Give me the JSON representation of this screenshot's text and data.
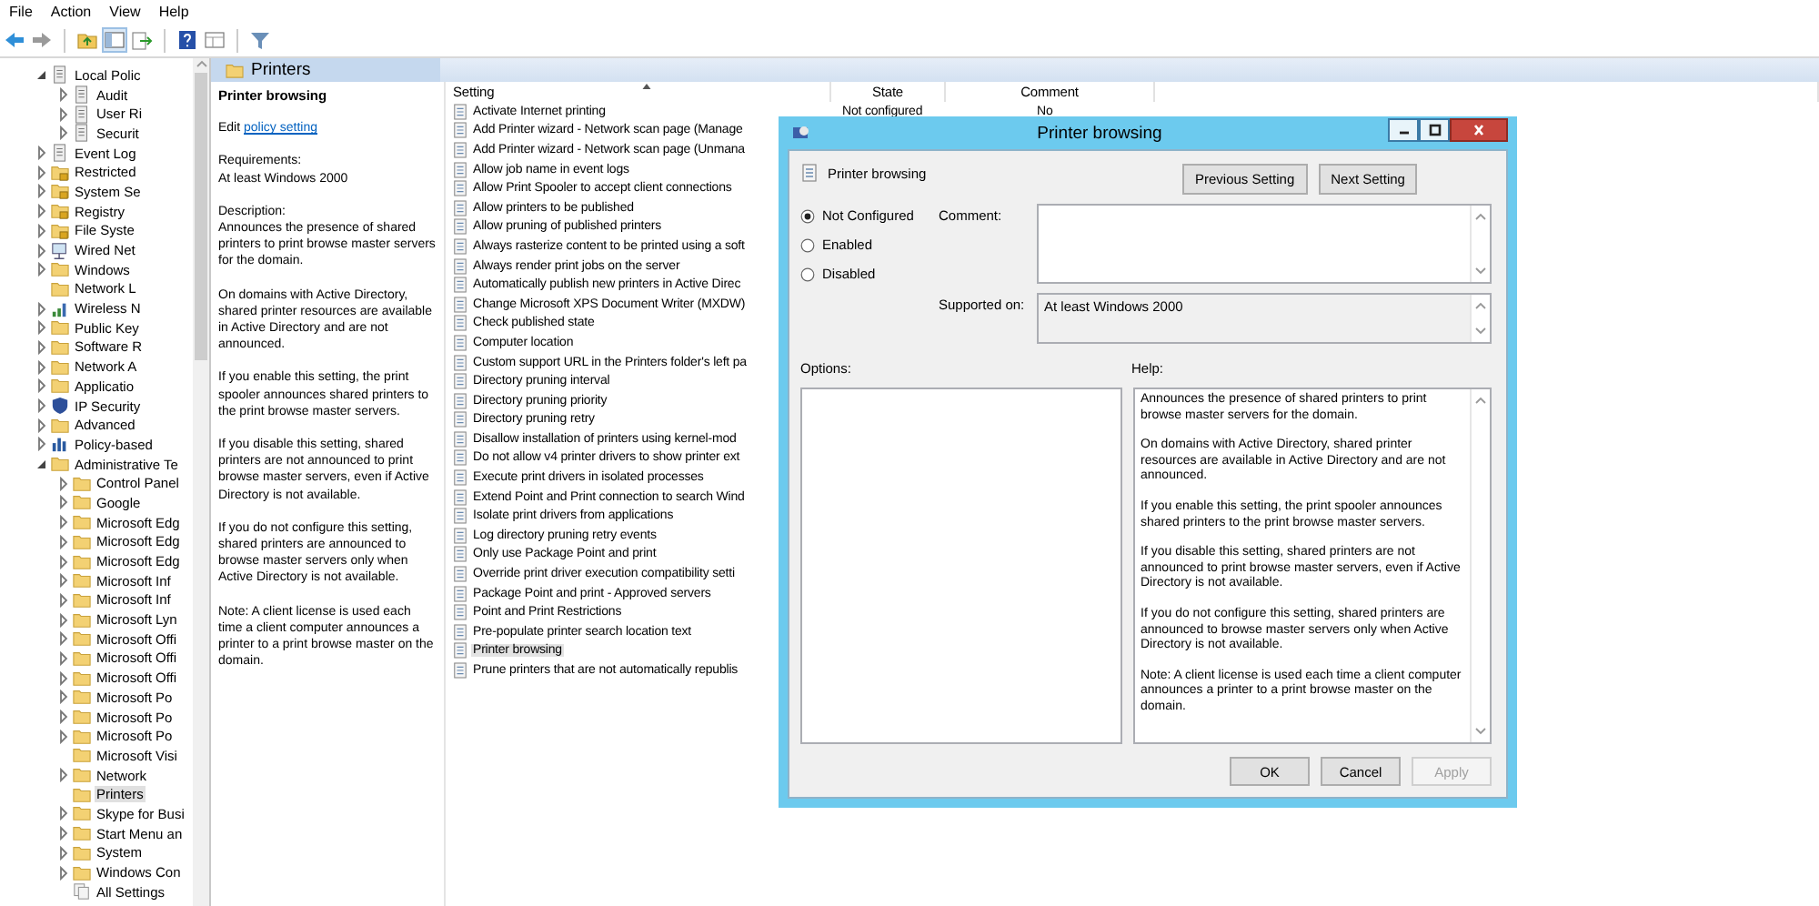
{
  "menu": [
    "File",
    "Action",
    "View",
    "Help"
  ],
  "tree": [
    {
      "label": "Local Polic",
      "kind": "policy",
      "expandable": true,
      "expanded": true,
      "selected": false,
      "children": [
        {
          "label": "Audit",
          "kind": "policy",
          "expandable": true,
          "expanded": false,
          "selected": false
        },
        {
          "label": "User Ri",
          "kind": "policy",
          "expandable": true,
          "expanded": false,
          "selected": false
        },
        {
          "label": "Securit",
          "kind": "policy",
          "expandable": true,
          "expanded": false,
          "selected": false
        }
      ]
    },
    {
      "label": "Event Log",
      "kind": "policy",
      "expandable": true,
      "expanded": false,
      "selected": false
    },
    {
      "label": "Restricted",
      "kind": "locked-folder",
      "expandable": true,
      "expanded": false,
      "selected": false
    },
    {
      "label": "System Se",
      "kind": "locked-folder",
      "expandable": true,
      "expanded": false,
      "selected": false
    },
    {
      "label": "Registry",
      "kind": "locked-folder",
      "expandable": true,
      "expanded": false,
      "selected": false
    },
    {
      "label": "File Syste",
      "kind": "locked-folder",
      "expandable": true,
      "expanded": false,
      "selected": false
    },
    {
      "label": "Wired Net",
      "kind": "network",
      "expandable": true,
      "expanded": false,
      "selected": false
    },
    {
      "label": "Windows",
      "kind": "folder",
      "expandable": true,
      "expanded": false,
      "selected": false
    },
    {
      "label": "Network L",
      "kind": "folder",
      "expandable": false,
      "selected": false
    },
    {
      "label": "Wireless N",
      "kind": "wireless",
      "expandable": true,
      "expanded": false,
      "selected": false
    },
    {
      "label": "Public Key",
      "kind": "folder",
      "expandable": true,
      "expanded": false,
      "selected": false
    },
    {
      "label": "Software R",
      "kind": "folder",
      "expandable": true,
      "expanded": false,
      "selected": false
    },
    {
      "label": "Network A",
      "kind": "folder",
      "expandable": true,
      "expanded": false,
      "selected": false
    },
    {
      "label": "Applicatio",
      "kind": "folder",
      "expandable": true,
      "expanded": false,
      "selected": false
    },
    {
      "label": "IP Security",
      "kind": "shield",
      "expandable": true,
      "expanded": false,
      "selected": false
    },
    {
      "label": "Advanced",
      "kind": "folder",
      "expandable": true,
      "expanded": false,
      "selected": false
    },
    {
      "label": "Policy-based",
      "kind": "chart",
      "expandable": true,
      "expanded": false,
      "selected": false
    },
    {
      "label": "Administrative Te",
      "kind": "folder",
      "expandable": true,
      "expanded": true,
      "selected": false,
      "children": [
        {
          "label": "Control Panel",
          "kind": "folder",
          "expandable": true,
          "expanded": false,
          "selected": false
        },
        {
          "label": "Google",
          "kind": "folder",
          "expandable": true,
          "expanded": false,
          "selected": false
        },
        {
          "label": "Microsoft Edg",
          "kind": "folder",
          "expandable": true,
          "expanded": false,
          "selected": false
        },
        {
          "label": "Microsoft Edg",
          "kind": "folder",
          "expandable": true,
          "expanded": false,
          "selected": false
        },
        {
          "label": "Microsoft Edg",
          "kind": "folder",
          "expandable": true,
          "expanded": false,
          "selected": false
        },
        {
          "label": "Microsoft Inf",
          "kind": "folder",
          "expandable": true,
          "expanded": false,
          "selected": false
        },
        {
          "label": "Microsoft Inf",
          "kind": "folder",
          "expandable": true,
          "expanded": false,
          "selected": false
        },
        {
          "label": "Microsoft Lyn",
          "kind": "folder",
          "expandable": true,
          "expanded": false,
          "selected": false
        },
        {
          "label": "Microsoft Offi",
          "kind": "folder",
          "expandable": true,
          "expanded": false,
          "selected": false
        },
        {
          "label": "Microsoft Offi",
          "kind": "folder",
          "expandable": true,
          "expanded": false,
          "selected": false
        },
        {
          "label": "Microsoft Offi",
          "kind": "folder",
          "expandable": true,
          "expanded": false,
          "selected": false
        },
        {
          "label": "Microsoft Po",
          "kind": "folder",
          "expandable": true,
          "expanded": false,
          "selected": false
        },
        {
          "label": "Microsoft Po",
          "kind": "folder",
          "expandable": true,
          "expanded": false,
          "selected": false
        },
        {
          "label": "Microsoft Po",
          "kind": "folder",
          "expandable": true,
          "expanded": false,
          "selected": false
        },
        {
          "label": "Microsoft Visi",
          "kind": "folder",
          "expandable": false,
          "selected": false
        },
        {
          "label": "Network",
          "kind": "folder",
          "expandable": true,
          "expanded": false,
          "selected": false
        },
        {
          "label": "Printers",
          "kind": "folder",
          "expandable": false,
          "selected": true
        },
        {
          "label": "Skype for Busi",
          "kind": "folder",
          "expandable": true,
          "expanded": false,
          "selected": false
        },
        {
          "label": "Start Menu an",
          "kind": "folder",
          "expandable": true,
          "expanded": false,
          "selected": false
        },
        {
          "label": "System",
          "kind": "folder",
          "expandable": true,
          "expanded": false,
          "selected": false
        },
        {
          "label": "Windows Con",
          "kind": "folder",
          "expandable": true,
          "expanded": false,
          "selected": false
        },
        {
          "label": "All Settings",
          "kind": "settings",
          "expandable": false,
          "selected": false
        }
      ]
    }
  ],
  "details": {
    "header": "Printers",
    "title": "Printer browsing",
    "edit_prefix": "Edit",
    "edit_link": "policy setting",
    "requirements_label": "Requirements:",
    "requirements": "At least Windows 2000",
    "description_label": "Description:",
    "paragraphs": [
      "Announces the presence of shared printers to print browse master servers for the domain.",
      "On domains with Active Directory, shared printer resources are available in Active Directory and are not announced.",
      "If you enable this setting, the print spooler announces shared printers to the print browse master servers.",
      "If you disable this setting, shared printers are not announced to print browse master servers, even if Active Directory is not available.",
      "If you do not configure this setting, shared printers are announced to browse master servers only when Active Directory is not available.",
      "Note: A client license is used each time a client computer announces a printer to a print browse master on the domain."
    ]
  },
  "list": {
    "columns": [
      "Setting",
      "State",
      "Comment"
    ],
    "rows": [
      {
        "setting": "Activate Internet printing",
        "state": "Not configured",
        "comment": "No",
        "selected": false
      },
      {
        "setting": "Add Printer wizard - Network scan page (Manage",
        "selected": false
      },
      {
        "setting": "Add Printer wizard - Network scan page (Unmana",
        "selected": false
      },
      {
        "setting": "Allow job name in event logs",
        "selected": false
      },
      {
        "setting": "Allow Print Spooler to accept client connections",
        "selected": false
      },
      {
        "setting": "Allow printers to be published",
        "selected": false
      },
      {
        "setting": "Allow pruning of published printers",
        "selected": false
      },
      {
        "setting": "Always rasterize content to be printed using a soft",
        "selected": false
      },
      {
        "setting": "Always render print jobs on the server",
        "selected": false
      },
      {
        "setting": "Automatically publish new printers in Active Direc",
        "selected": false
      },
      {
        "setting": "Change Microsoft XPS Document Writer (MXDW)",
        "selected": false
      },
      {
        "setting": "Check published state",
        "selected": false
      },
      {
        "setting": "Computer location",
        "selected": false
      },
      {
        "setting": "Custom support URL in the Printers folder's left pa",
        "selected": false
      },
      {
        "setting": "Directory pruning interval",
        "selected": false
      },
      {
        "setting": "Directory pruning priority",
        "selected": false
      },
      {
        "setting": "Directory pruning retry",
        "selected": false
      },
      {
        "setting": "Disallow installation of printers using kernel-mod",
        "selected": false
      },
      {
        "setting": "Do not allow v4 printer drivers to show printer ext",
        "selected": false
      },
      {
        "setting": "Execute print drivers in isolated processes",
        "selected": false
      },
      {
        "setting": "Extend Point and Print connection to search Wind",
        "selected": false
      },
      {
        "setting": "Isolate print drivers from applications",
        "selected": false
      },
      {
        "setting": "Log directory pruning retry events",
        "selected": false
      },
      {
        "setting": "Only use Package Point and print",
        "selected": false
      },
      {
        "setting": "Override print driver execution compatibility setti",
        "selected": false
      },
      {
        "setting": "Package Point and print - Approved servers",
        "selected": false
      },
      {
        "setting": "Point and Print Restrictions",
        "selected": false
      },
      {
        "setting": "Pre-populate printer search location text",
        "selected": false
      },
      {
        "setting": "Printer browsing",
        "selected": true
      },
      {
        "setting": "Prune printers that are not automatically republis",
        "selected": false
      }
    ]
  },
  "dialog": {
    "title": "Printer browsing",
    "policy_name": "Printer browsing",
    "nav_buttons": [
      "Previous Setting",
      "Next Setting"
    ],
    "options": [
      {
        "label": "Not Configured",
        "selected": true
      },
      {
        "label": "Enabled",
        "selected": false
      },
      {
        "label": "Disabled",
        "selected": false
      }
    ],
    "comment_label": "Comment:",
    "supported_label": "Supported on:",
    "supported_value": "At least Windows 2000",
    "options_label": "Options:",
    "help_label": "Help:",
    "help_paragraphs": [
      "Announces the presence of shared printers to print browse master servers for the domain.",
      "On domains with Active Directory, shared printer resources are available in Active Directory and are not announced.",
      "If you enable this setting, the print spooler announces shared printers to the print browse master servers.",
      "If you disable this setting, shared printers are not announced to print browse master servers, even if Active Directory is not available.",
      "If you do not configure this setting, shared printers are announced to browse master servers only when Active Directory is not available.",
      "Note: A client license is used each time a client computer announces a printer to a print browse master on the domain."
    ],
    "footer_buttons": [
      {
        "label": "OK",
        "disabled": false
      },
      {
        "label": "Cancel",
        "disabled": false
      },
      {
        "label": "Apply",
        "disabled": true
      }
    ]
  }
}
